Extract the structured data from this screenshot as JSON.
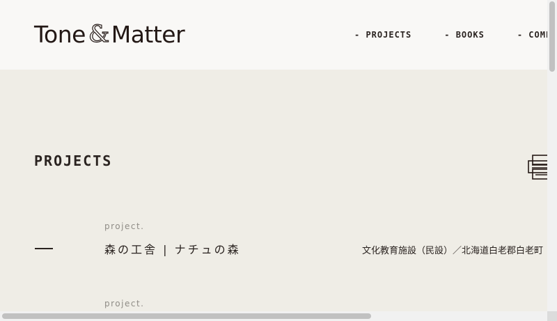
{
  "brand": {
    "word1": "Tone",
    "amp": "&",
    "word2": "Matter"
  },
  "nav": [
    {
      "label": "- PROJECTS"
    },
    {
      "label": "- BOOKS"
    },
    {
      "label": "- COMPANY"
    }
  ],
  "section": {
    "title": "PROJECTS"
  },
  "projects": [
    {
      "label": "project.",
      "title": "森の工舎 | ナチュの森",
      "meta": "文化教育施設（民設）／北海道白老郡白老町"
    },
    {
      "label": "project.",
      "title": "",
      "meta": ""
    }
  ],
  "icons": {
    "view_toggle": "list-view-icon"
  },
  "colors": {
    "header_bg": "#f9f8f6",
    "page_bg": "#efede6",
    "text": "#2a2320",
    "muted": "#8f8c86"
  }
}
